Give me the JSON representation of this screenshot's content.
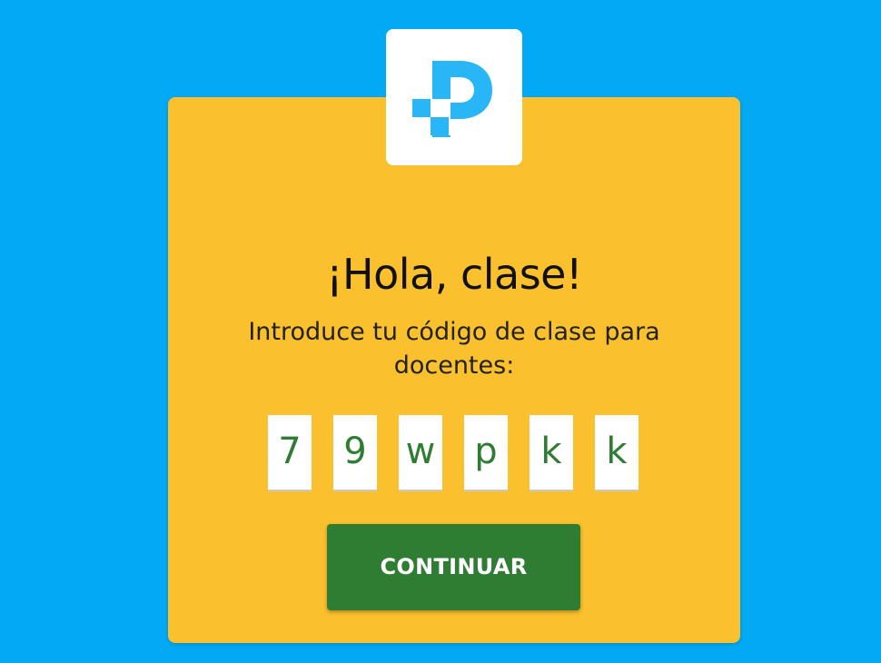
{
  "colors": {
    "background": "#03A9F4",
    "card": "#FBC02D",
    "logo_blue": "#29B6F6",
    "button": "#2E7D32",
    "code_text": "#2E7D32"
  },
  "logo": {
    "icon": "p-logo-icon"
  },
  "greeting": {
    "title": "¡Hola, clase!",
    "subtitle": "Introduce tu código de clase para docentes:"
  },
  "class_code": {
    "characters": [
      "7",
      "9",
      "w",
      "p",
      "k",
      "k"
    ]
  },
  "actions": {
    "continue_label": "CONTINUAR"
  }
}
